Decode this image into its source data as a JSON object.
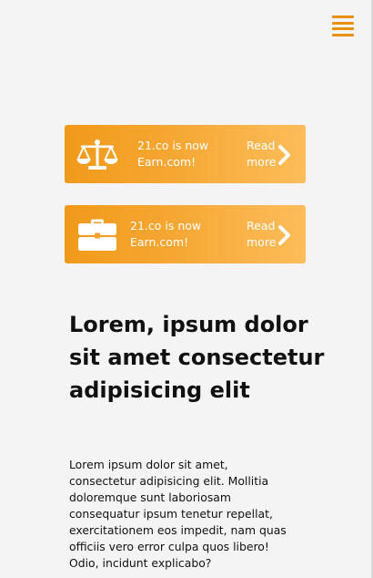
{
  "header": {
    "menu_icon": "hamburger-menu-icon"
  },
  "banners": [
    {
      "icon": "scales-icon",
      "line1": "21.co is now",
      "line2": "Earn.com!",
      "read": "Read",
      "more": "more",
      "chevron_icon": "chevron-right-icon"
    },
    {
      "icon": "briefcase-icon",
      "line1": "21.co is now",
      "line2": "Earn.com!",
      "read": "Read",
      "more": "more",
      "chevron_icon": "chevron-right-icon"
    }
  ],
  "article": {
    "headline": "Lorem, ipsum dolor sit amet consectetur adipisicing elit",
    "body": "Lorem ipsum dolor sit amet, consectetur adipisicing elit. Mollitia doloremque sunt laboriosam consequatur ipsum tenetur repellat, exercitationem eos impedit, nam quas officiis vero error culpa quos libero! Odio, incidunt explicabo?"
  },
  "colors": {
    "accent": "#e8900f",
    "banner_start": "#f09a1a",
    "banner_end": "#fdbd5b",
    "background": "#f4f4f4"
  }
}
